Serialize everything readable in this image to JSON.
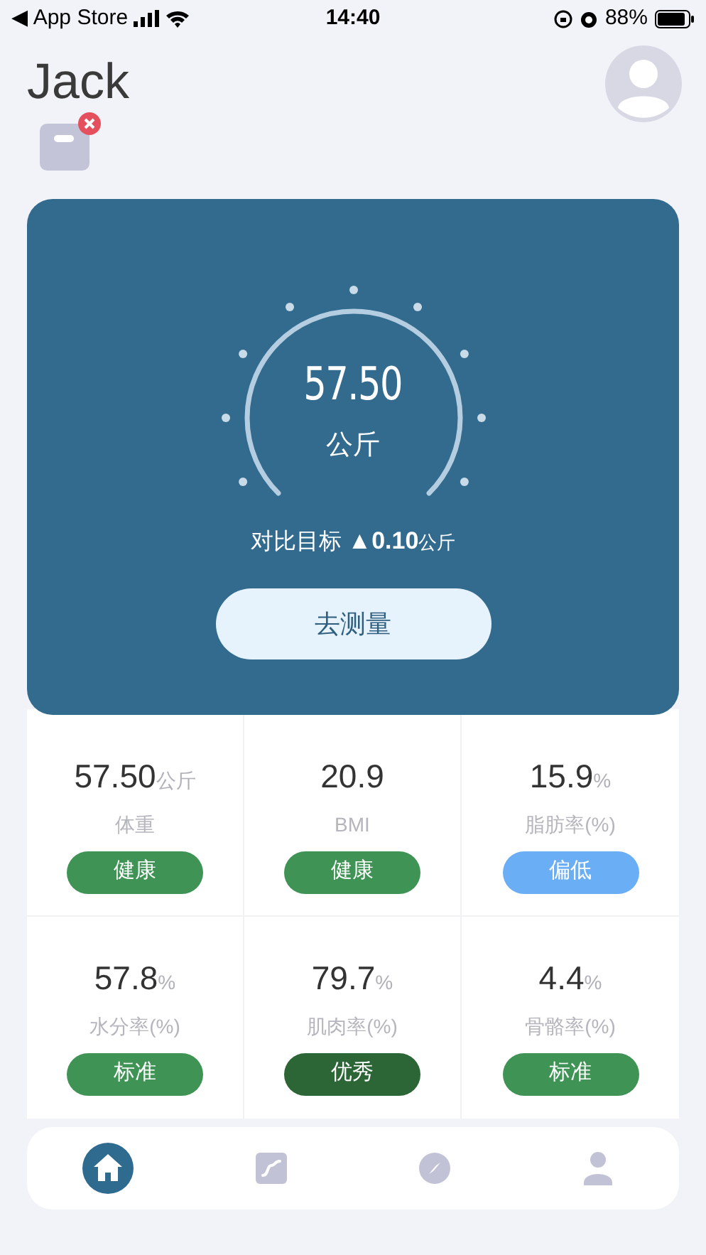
{
  "status_bar": {
    "back": "◀ App Store",
    "time": "14:40",
    "battery": "88%"
  },
  "header": {
    "name": "Jack"
  },
  "gauge": {
    "value": "57.50",
    "unit": "公斤",
    "compare_label": "对比目标",
    "compare_delta": "▲0.10",
    "compare_unit": "公斤",
    "button": "去测量"
  },
  "metrics": [
    {
      "value": "57.50",
      "unit": "公斤",
      "label": "体重",
      "status": "健康",
      "color": "#3f9455"
    },
    {
      "value": "20.9",
      "label": "BMI",
      "status": "健康",
      "color": "#3f9455"
    },
    {
      "value": "15.9",
      "unit": "%",
      "label": "脂肪率(%)",
      "status": "偏低",
      "color": "#6aaef5"
    },
    {
      "value": "57.8",
      "unit": "%",
      "label": "水分率(%)",
      "status": "标准",
      "color": "#3f9455"
    },
    {
      "value": "79.7",
      "unit": "%",
      "label": "肌肉率(%)",
      "status": "优秀",
      "color": "#2c6636"
    },
    {
      "value": "4.4",
      "unit": "%",
      "label": "骨骼率(%)",
      "status": "标准",
      "color": "#3f9455"
    }
  ],
  "tab_bar": [
    {
      "kind": "home",
      "selected": true
    },
    {
      "kind": "chart",
      "selected": false
    },
    {
      "kind": "compass",
      "selected": false
    },
    {
      "kind": "profile",
      "selected": false
    }
  ]
}
